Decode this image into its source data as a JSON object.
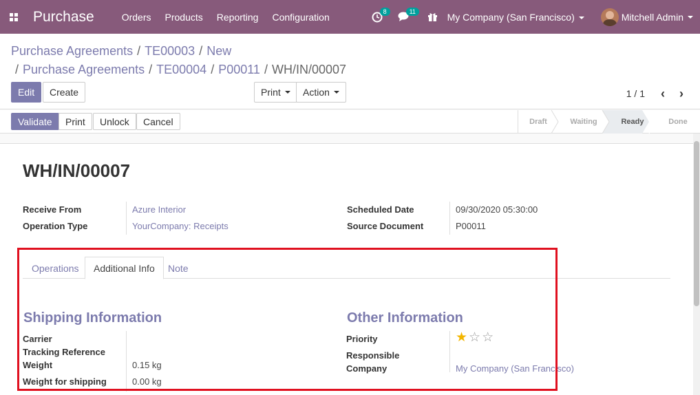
{
  "navbar": {
    "app_name": "Purchase",
    "menu": [
      "Orders",
      "Products",
      "Reporting",
      "Configuration"
    ],
    "activity_count": "8",
    "message_count": "11",
    "company": "My Company (San Francisco)",
    "user": "Mitchell Admin"
  },
  "breadcrumb": {
    "line1": [
      "Purchase Agreements",
      "TE00003",
      "New"
    ],
    "line2": [
      "Purchase Agreements",
      "TE00004",
      "P00011",
      "WH/IN/00007"
    ]
  },
  "toolbar": {
    "edit": "Edit",
    "create": "Create",
    "print": "Print",
    "action": "Action",
    "pager": "1 / 1"
  },
  "statusbar": {
    "buttons": [
      "Validate",
      "Print",
      "Unlock",
      "Cancel"
    ],
    "stages": [
      "Draft",
      "Waiting",
      "Ready",
      "Done"
    ],
    "current_stage": "Ready"
  },
  "record": {
    "name": "WH/IN/00007",
    "receive_from_label": "Receive From",
    "receive_from": "Azure Interior",
    "operation_type_label": "Operation Type",
    "operation_type": "YourCompany: Receipts",
    "scheduled_date_label": "Scheduled Date",
    "scheduled_date": "09/30/2020 05:30:00",
    "source_document_label": "Source Document",
    "source_document": "P00011"
  },
  "tabs": [
    "Operations",
    "Additional Info",
    "Note"
  ],
  "shipping": {
    "title": "Shipping Information",
    "carrier_label": "Carrier",
    "tracking_label": "Tracking Reference",
    "weight_label": "Weight",
    "weight": "0.15 kg",
    "weight_shipping_label": "Weight for shipping",
    "weight_shipping": "0.00 kg"
  },
  "other": {
    "title": "Other Information",
    "priority_label": "Priority",
    "priority_stars": 1,
    "responsible_label_1": "Responsible",
    "responsible_label_2": "Company",
    "company": "My Company (San Francisco)"
  },
  "colors": {
    "brand": "#875a7b",
    "primary": "#7c7bad",
    "highlight_box": "#e0101f",
    "star": "#f3b600"
  },
  "icons": [
    "apps-grid-icon",
    "activity-clock-icon",
    "chat-bubble-icon",
    "gift-icon",
    "chevron-left-icon",
    "chevron-right-icon",
    "star-icon"
  ]
}
